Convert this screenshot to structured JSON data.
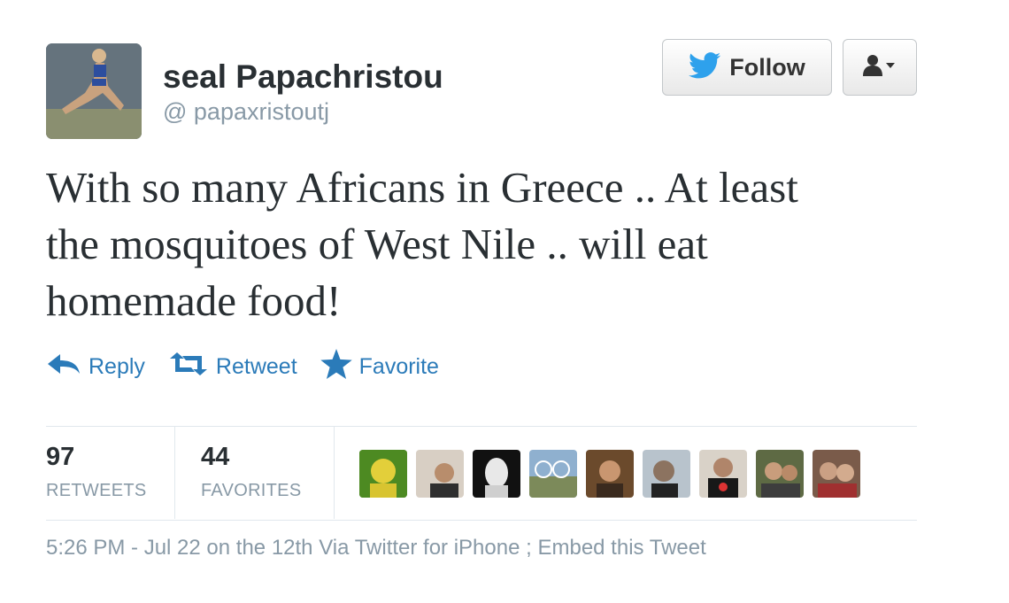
{
  "author": {
    "display_name": "seal Papachristou",
    "handle": "@ papaxristoutj"
  },
  "follow_button": {
    "label": "Follow"
  },
  "tweet": {
    "text_lines": [
      "With so many Africans in Greece .. At least",
      "the mosquitoes of West Nile .. will eat",
      "homemade food!"
    ]
  },
  "actions": {
    "reply": "Reply",
    "retweet": "Retweet",
    "favorite": "Favorite"
  },
  "stats": {
    "retweets_count": "97",
    "retweets_label": "RETWEETS",
    "favorites_count": "44",
    "favorites_label": "FAVORITES"
  },
  "footer": {
    "timestamp": "5:26 PM - Jul 22 on the 12th",
    "via": "Via Twitter for iPhone",
    "separator": ";",
    "embed": "Embed this Tweet"
  },
  "colors": {
    "link_blue": "#2b7bb9",
    "twitter_bird": "#2ea1ec",
    "muted_gray": "#8899a6",
    "text_dark": "#292f33"
  },
  "icons": {
    "follow": "twitter-bird-icon",
    "user_menu": "user-dropdown-icon",
    "reply": "reply-arrow-icon",
    "retweet": "retweet-icon",
    "favorite": "star-icon"
  }
}
